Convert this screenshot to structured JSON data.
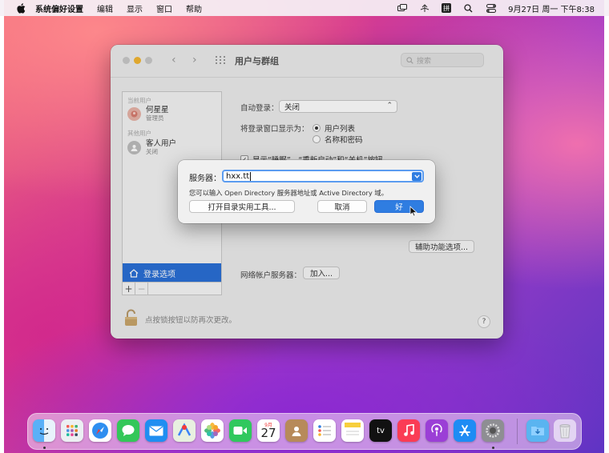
{
  "menubar": {
    "app_name": "系统偏好设置",
    "items": [
      "编辑",
      "显示",
      "窗口",
      "帮助"
    ],
    "ime_label": "拼",
    "clock": "9月27日 周一 下午8:38"
  },
  "window": {
    "title": "用户与群组",
    "search_placeholder": "搜索"
  },
  "sidebar": {
    "current_users_header": "当前用户",
    "current_user_name": "何星星",
    "current_user_role": "管理员",
    "other_users_header": "其他用户",
    "guest_name": "客人用户",
    "guest_status": "关闭",
    "login_options_label": "登录选项",
    "add_symbol": "+",
    "remove_symbol": "−"
  },
  "login_options": {
    "auto_login_label": "自动登录：",
    "auto_login_value": "关闭",
    "display_as_label": "将登录窗口显示为：",
    "radio_user_list": "用户列表",
    "radio_name_password": "名称和密码",
    "show_buttons_checkbox": "显示“睡眠”、“重新启动”和“关机”按钮",
    "accessibility_button": "辅助功能选项...",
    "network_server_label": "网络帐户服务器：",
    "join_button": "加入..."
  },
  "lock": {
    "text": "点按锁按钮以防再次更改。"
  },
  "help_label": "?",
  "dialog": {
    "server_label": "服务器：",
    "server_value": "hxx.tt",
    "hint": "您可以输入 Open Directory 服务器地址或 Active Directory 域。",
    "open_directory_button": "打开目录实用工具...",
    "cancel_button": "取消",
    "ok_button": "好"
  },
  "dock": {
    "calendar_month": "9月",
    "calendar_day": "27",
    "tv_label": "tv"
  },
  "colors": {
    "accent": "#2f7de1",
    "selected_sidebar": "#2a6fd6"
  }
}
